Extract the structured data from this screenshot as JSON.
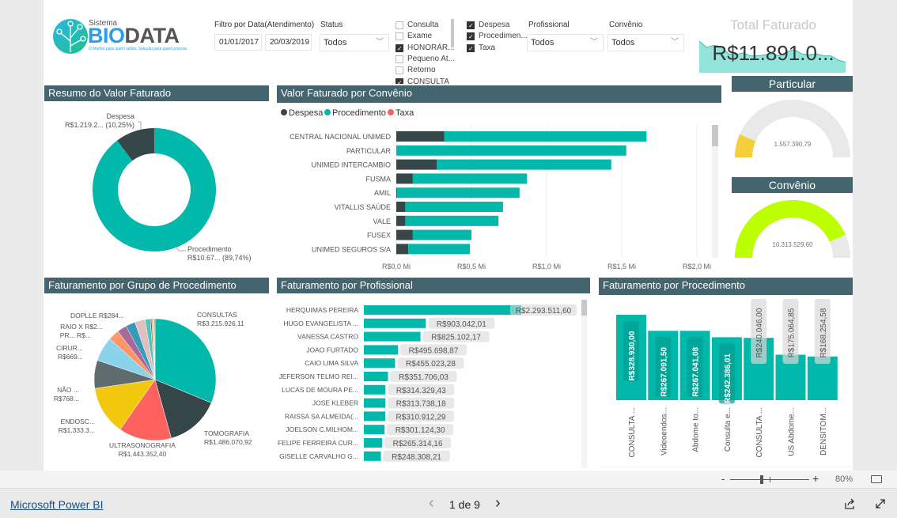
{
  "colors": {
    "header": "#44646e",
    "teal": "#01b8aa",
    "dark": "#374649",
    "red": "#fd625e",
    "yellow": "#f2c80f",
    "gauge_particular": "#f5cf3b",
    "gauge_convenio": "#bbff00",
    "track": "#e9e9e9",
    "spark": "#94e3db"
  },
  "logo": {
    "small": "Sistema",
    "bio": "BIO",
    "data": "DATA",
    "tagline": "O Melhor para quem utiliza. Solução para quem precisa."
  },
  "filters": {
    "date_label": "Filtro por Data(Atendimento)",
    "date_from": "01/01/2017",
    "date_to": "20/03/2019",
    "status_label": "Status",
    "status_value": "Todos",
    "tipo_items": [
      {
        "label": "Consulta",
        "checked": false
      },
      {
        "label": "Exame",
        "checked": false
      },
      {
        "label": "HONORÁR...",
        "checked": true
      },
      {
        "label": "Pequeno At...",
        "checked": false
      },
      {
        "label": "Retorno",
        "checked": false
      },
      {
        "label": "CONSULTA",
        "checked": true
      }
    ],
    "categoria_items": [
      {
        "label": "Despesa",
        "checked": true
      },
      {
        "label": "Procedimen...",
        "checked": true
      },
      {
        "label": "Taxa",
        "checked": true
      }
    ],
    "profissional_label": "Profissional",
    "profissional_value": "Todos",
    "convenio_label": "Convênio",
    "convenio_value": "Todos"
  },
  "total_card": {
    "title": "Total Faturado",
    "value": "R$11.891.0...",
    "sparkline": [
      30,
      24,
      26,
      25,
      18,
      17,
      19,
      16,
      16,
      17,
      18,
      16,
      20,
      22,
      18,
      17,
      18,
      16,
      16,
      12,
      10
    ]
  },
  "headers": {
    "resumo": "Resumo do Valor Faturado",
    "convenio_chart": "Valor Faturado por Convênio",
    "particular": "Particular",
    "convenio_gauge": "Convênio",
    "grupo": "Faturamento por Grupo de Procedimento",
    "profissional": "Faturamento por Profissional",
    "procedimento": "Faturamento por Procedimento"
  },
  "chart_data": [
    {
      "id": "resumo",
      "type": "pie",
      "donut": true,
      "slices": [
        {
          "name": "Procedimento",
          "label": "R$10.67... (89,74%)",
          "percent": 89.74,
          "color": "#01b8aa"
        },
        {
          "name": "Despesa",
          "label": "R$1.219.2... (10,25%)",
          "percent": 10.25,
          "color": "#374649"
        }
      ]
    },
    {
      "id": "convenio",
      "type": "bar",
      "orientation": "horizontal",
      "stacked": true,
      "legend": [
        "Despesa",
        "Procedimento",
        "Taxa"
      ],
      "legend_colors": [
        "#374649",
        "#01b8aa",
        "#fd625e"
      ],
      "legend_position": "top-left",
      "categories": [
        "CENTRAL NACIONAL UNIMED",
        "PARTICULAR",
        "UNIMED INTERCAMBIO",
        "FUSMA",
        "AMIL",
        "VITALLIS SAÚDE",
        "VALE",
        "FUSEX",
        "UNIMED SEGUROS S/A"
      ],
      "series": [
        {
          "name": "Despesa",
          "values": [
            0.32,
            0,
            0.27,
            0.11,
            0.005,
            0.06,
            0.06,
            0.11,
            0.08
          ]
        },
        {
          "name": "Procedimento",
          "values": [
            1.345,
            1.53,
            1.16,
            0.76,
            0.815,
            0.65,
            0.62,
            0.39,
            0.41
          ]
        },
        {
          "name": "Taxa",
          "values": [
            0,
            0,
            0,
            0,
            0,
            0,
            0,
            0,
            0
          ]
        }
      ],
      "xlim": [
        0,
        2.0
      ],
      "xticks": [
        "R$0,0 Mi",
        "R$0,5 Mi",
        "R$1,0 Mi",
        "R$1,5 Mi",
        "R$2,0 Mi"
      ],
      "grid": true
    },
    {
      "id": "particular",
      "type": "gauge",
      "value": 1557390.79,
      "label": "1.557.390,79",
      "max": 11870920.39
    },
    {
      "id": "convenio_gauge",
      "type": "gauge",
      "value": 10313529.6,
      "label": "10.313.529,60",
      "max": 11870920.39
    },
    {
      "id": "grupo",
      "type": "pie",
      "slices": [
        {
          "name": "CONSULTAS",
          "label": "R$3.215.926,11",
          "value": 3215926.11,
          "color": "#01b8aa"
        },
        {
          "name": "TOMOGRAFIA",
          "label": "R$1.486.070,92",
          "value": 1486070.92,
          "color": "#374649"
        },
        {
          "name": "ULTRASONOGRAFIA",
          "label": "R$1.443.352,40",
          "value": 1443352.4,
          "color": "#fd625e"
        },
        {
          "name": "ENDOSC...",
          "label": "R$1.333.3...",
          "value": 1333300,
          "color": "#f2c80f"
        },
        {
          "name": "NÃO ...",
          "label": "R$768...",
          "value": 768000,
          "color": "#5f6b6d"
        },
        {
          "name": "CIRUR...",
          "label": "R$669...",
          "value": 669000,
          "color": "#8ad4eb"
        },
        {
          "name": "PR...",
          "label": "R$...",
          "value": 300000,
          "color": "#fe9666"
        },
        {
          "name": "RAIO X",
          "label": "R$2...",
          "value": 260000,
          "color": "#a66999"
        },
        {
          "name": "",
          "label": "",
          "value": 260000,
          "color": "#3599b8"
        },
        {
          "name": "DOPLLE",
          "label": "R$284...",
          "value": 284000,
          "color": "#dfbfbf"
        },
        {
          "name": "",
          "label": "",
          "value": 140000,
          "color": "#4ac5bb"
        },
        {
          "name": "",
          "label": "",
          "value": 40000,
          "color": "#5f6b6d"
        },
        {
          "name": "",
          "label": "",
          "value": 35000,
          "color": "#fb8281"
        },
        {
          "name": "",
          "label": "",
          "value": 30000,
          "color": "#f4d25a"
        },
        {
          "name": "",
          "label": "",
          "value": 25000,
          "color": "#7f898a"
        }
      ]
    },
    {
      "id": "profissional",
      "type": "bar",
      "orientation": "horizontal",
      "categories": [
        "HERQUIMAS PEREIRA",
        "HUGO EVANGELISTA ...",
        "VANESSA CASTRO",
        "JOAO FURTADO",
        "CAIO LIMA SILVA",
        "JEFERSON TELMO REI...",
        "LUCAS DE MOURA PE...",
        "JOSE KLEBER",
        "RAISSA SA ALMEIDA(...",
        "JOELSON C.MILHOM...",
        "FELIPE FERREIRA CUR...",
        "GISELLE CARVALHO G..."
      ],
      "values": [
        2293511.6,
        903042.01,
        825102.17,
        495698.87,
        455023.28,
        351706.03,
        314329.43,
        313738.18,
        310912.29,
        301124.3,
        265314.16,
        248308.21
      ],
      "labels": [
        "R$2.293.511,60",
        "R$903.042,01",
        "R$825.102,17",
        "R$495.698,87",
        "R$455.023,28",
        "R$351.706,03",
        "R$314.329,43",
        "R$313.738,18",
        "R$310.912,29",
        "R$301.124,30",
        "R$265.314,16",
        "R$248.308,21"
      ]
    },
    {
      "id": "procedimento",
      "type": "bar",
      "orientation": "vertical",
      "categories": [
        "CONSULTA ...",
        "Videoendos...",
        "Abdome to...",
        "Consulta e...",
        "CONSULTA ...",
        "US Abdome...",
        "DENSITOM..."
      ],
      "values": [
        328930.0,
        267091.5,
        267041.08,
        242386.01,
        240046.0,
        175064.85,
        168254.58
      ],
      "labels": [
        "R$328.930,00",
        "R$267.091,50",
        "R$267.041,08",
        "R$242.386,01",
        "R$240.046,00",
        "R$175.064,85",
        "R$168.254,58"
      ]
    }
  ],
  "footer": {
    "zoom_minus": "-",
    "zoom_plus": "+",
    "zoom_level": "80%",
    "zoom_fraction": 0.4,
    "brand": "Microsoft Power BI",
    "page_text": "1 de 9",
    "prev": "‹",
    "next": "›"
  }
}
